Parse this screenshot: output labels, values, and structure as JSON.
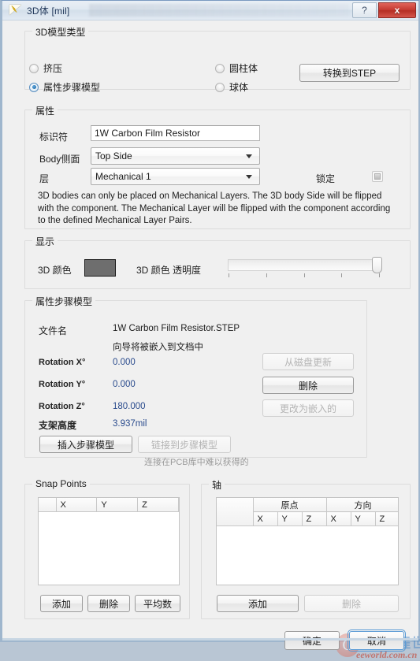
{
  "window": {
    "title": "3D体 [mil]",
    "icon": "3d-body-icon",
    "help_button": "?",
    "close_button": "x"
  },
  "model_type": {
    "legend": "3D模型类型",
    "options": [
      {
        "label": "挤压",
        "selected": false
      },
      {
        "label": "属性步骤模型",
        "selected": true
      },
      {
        "label": "圆柱体",
        "selected": false
      },
      {
        "label": "球体",
        "selected": false
      }
    ],
    "convert_button": "转换到STEP"
  },
  "properties": {
    "legend": "属性",
    "identifier_label": "标识符",
    "identifier_value": "1W Carbon Film Resistor",
    "body_side_label": "Body侧面",
    "body_side_value": "Top Side",
    "layer_label": "层",
    "layer_value": "Mechanical 1",
    "lock_label": "锁定",
    "lock_checked": false,
    "note": "3D bodies can only be placed on Mechanical Layers. The 3D body Side will be flipped with the component. The Mechanical Layer will be flipped with the component according to the defined Mechanical Layer Pairs."
  },
  "display": {
    "legend": "显示",
    "color_label": "3D 颜色",
    "color_value": "#6e6e6e",
    "opacity_label": "3D 颜色 透明度",
    "opacity_percent": 100,
    "tick_count": 5
  },
  "step_model": {
    "legend": "属性步骤模型",
    "filename_label": "文件名",
    "filename_value": "1W Carbon Film Resistor.STEP",
    "embedded_note": "向导将被嵌入到文档中",
    "rotation_x_label": "Rotation X°",
    "rotation_x_value": "0.000",
    "rotation_y_label": "Rotation Y°",
    "rotation_y_value": "0.000",
    "rotation_z_label": "Rotation Z°",
    "rotation_z_value": "180.000",
    "standoff_label": "支架高度",
    "standoff_value": "3.937mil",
    "update_from_disk_button": "从磁盘更新",
    "delete_button": "删除",
    "change_to_embedded_button": "更改为嵌入的",
    "insert_step_button": "插入步骤模型",
    "link_step_button": "链接到步骤模型",
    "link_hint": "连接在PCB库中难以获得的"
  },
  "snap_points": {
    "legend": "Snap Points",
    "columns": [
      "",
      "X",
      "Y",
      "Z"
    ],
    "rows": [],
    "add_button": "添加",
    "delete_button": "删除",
    "average_button": "平均数"
  },
  "axis": {
    "legend": "轴",
    "group_headers": [
      "",
      "原点",
      "方向"
    ],
    "sub_columns": [
      "X",
      "Y",
      "Z",
      "X",
      "Y",
      "Z"
    ],
    "rows": [],
    "add_button": "添加",
    "delete_button": "删除"
  },
  "footer": {
    "ok_button": "确定",
    "cancel_button": "取消"
  },
  "watermark": {
    "logo_letter": "C",
    "cn_text": "电子工程世界",
    "url_text": "eeworld.com.cn"
  }
}
